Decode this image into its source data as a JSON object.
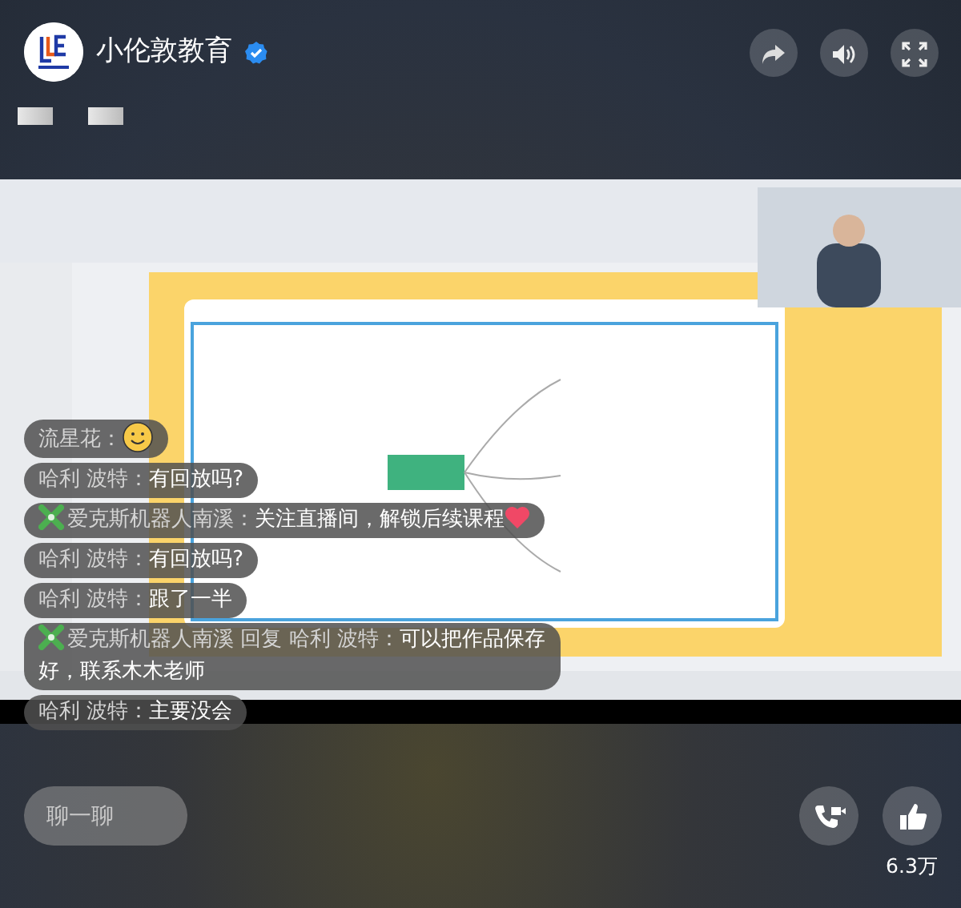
{
  "header": {
    "channel_name": "小伦敦教育",
    "verified": true
  },
  "chat": [
    {
      "kind": "smiley",
      "user": "流星花：",
      "badge": false
    },
    {
      "kind": "plain",
      "user": "哈利 波特：",
      "text": "有回放吗?",
      "badge": false
    },
    {
      "kind": "heart",
      "user": "爱克斯机器人南溪：",
      "text": "关注直播间，解锁后续课程",
      "badge": true
    },
    {
      "kind": "plain",
      "user": "哈利 波特：",
      "text": "有回放吗?",
      "badge": false
    },
    {
      "kind": "plain",
      "user": "哈利 波特：",
      "text": "跟了一半",
      "badge": false
    },
    {
      "kind": "plain",
      "user": "爱克斯机器人南溪 回复 哈利 波特：",
      "text": "可以把作品保存好，联系木木老师",
      "badge": true
    },
    {
      "kind": "plain",
      "user": "哈利 波特：",
      "text": "主要没会",
      "badge": false
    }
  ],
  "chat_input": {
    "placeholder": "聊一聊"
  },
  "likes": "6.3万"
}
